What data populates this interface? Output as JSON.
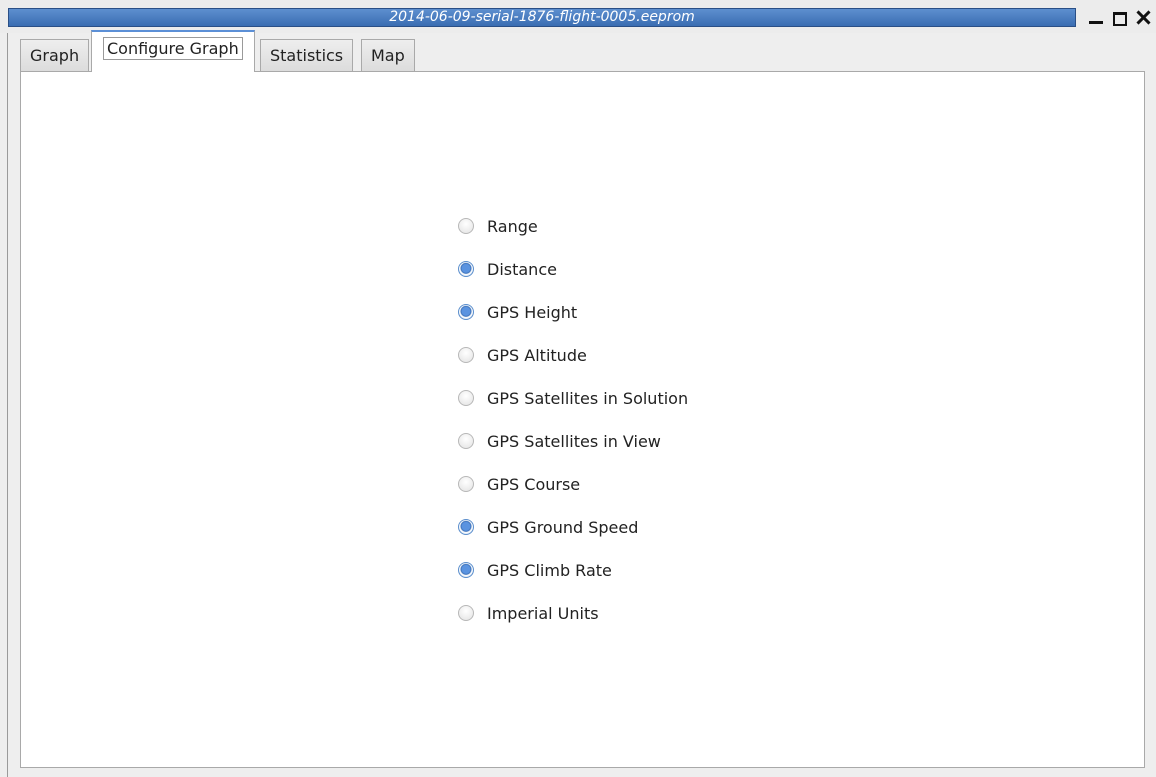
{
  "window": {
    "title": "2014-06-09-serial-1876-flight-0005.eeprom",
    "controls": [
      "minimize-icon",
      "maximize-icon",
      "close-icon"
    ]
  },
  "tabs": [
    {
      "label": "Graph",
      "active": false
    },
    {
      "label": "Configure Graph",
      "active": true
    },
    {
      "label": "Statistics",
      "active": false
    },
    {
      "label": "Map",
      "active": false
    }
  ],
  "options": [
    {
      "label": "Range",
      "checked": false
    },
    {
      "label": "Distance",
      "checked": true
    },
    {
      "label": "GPS Height",
      "checked": true
    },
    {
      "label": "GPS Altitude",
      "checked": false
    },
    {
      "label": "GPS Satellites in Solution",
      "checked": false
    },
    {
      "label": "GPS Satellites in View",
      "checked": false
    },
    {
      "label": "GPS Course",
      "checked": false
    },
    {
      "label": "GPS Ground Speed",
      "checked": true
    },
    {
      "label": "GPS Climb Rate",
      "checked": true
    },
    {
      "label": "Imperial Units",
      "checked": false
    }
  ],
  "colors": {
    "accent": "#4a7fc4",
    "title_bar": "#4a7fc4"
  }
}
